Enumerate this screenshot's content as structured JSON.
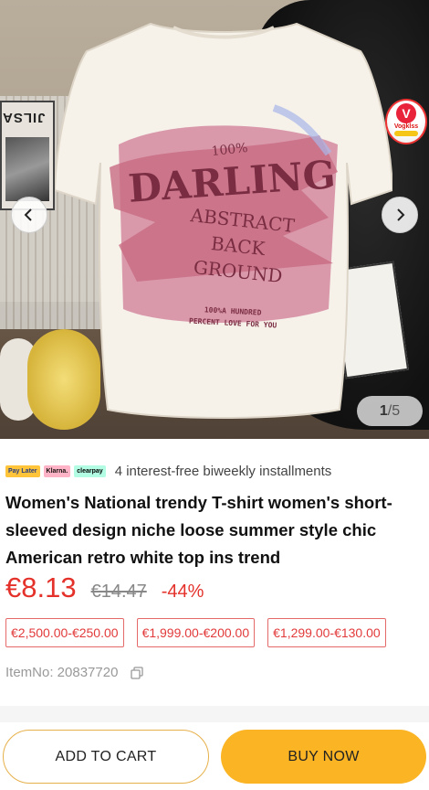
{
  "gallery": {
    "current": "1",
    "separator": "/",
    "total": "5",
    "shirt_print": {
      "line1": "100%",
      "line2": "DARLING",
      "line3": "ABSTRACT",
      "line4": "BACK",
      "line5": "GROUND",
      "line6": "100%A HUNDRED",
      "line7": "PERCENT LOVE FOR YOU"
    },
    "book_text": "JILSA",
    "logo_text": "Vogklss"
  },
  "payment": {
    "badges": [
      "Pay Later",
      "Klarna.",
      "clearpay"
    ],
    "text": "4 interest-free biweekly installments"
  },
  "product": {
    "title": "Women's National trendy T-shirt women's short-sleeved design niche loose summer style chic American retro white top ins trend",
    "price": "€8.13",
    "original_price": "€14.47",
    "discount": "-44%",
    "price_ranges": [
      "€2,500.00-€250.00",
      "€1,999.00-€200.00",
      "€1,299.00-€130.00"
    ],
    "item_no_label": "ItemNo: 20837720"
  },
  "actions": {
    "add_to_cart": "ADD TO CART",
    "buy_now": "BUY NOW"
  },
  "colors": {
    "price_red": "#e4322b",
    "buy_yellow": "#fbb423",
    "cart_border": "#e6b04a",
    "print_pink": "#c86b82"
  }
}
